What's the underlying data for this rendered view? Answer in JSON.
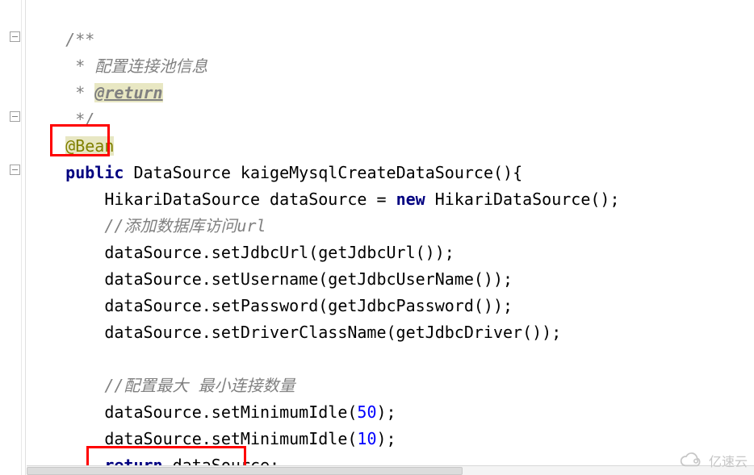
{
  "code": {
    "l1": "    /**",
    "l2_a": "     * ",
    "l2_b": "配置连接池信息",
    "l3_a": "     * ",
    "l3_b": "@return",
    "l4": "     */",
    "l5_a": "    ",
    "l5_b": "@Bean",
    "l6_a": "    ",
    "l6_b": "public",
    "l6_c": " DataSource kaigeMysqlCreateDataSource(){",
    "l7_a": "        HikariDataSource dataSource = ",
    "l7_b": "new",
    "l7_c": " HikariDataSource();",
    "l8_a": "        ",
    "l8_b": "//添加数据库访问url",
    "l9": "        dataSource.setJdbcUrl(getJdbcUrl());",
    "l10": "        dataSource.setUsername(getJdbcUserName());",
    "l11": "        dataSource.setPassword(getJdbcPassword());",
    "l12": "        dataSource.setDriverClassName(getJdbcDriver());",
    "l13": "",
    "l14_a": "        ",
    "l14_b": "//配置最大 最小连接数量",
    "l15_a": "        dataSource.setMinimumIdle(",
    "l15_b": "50",
    "l15_c": ");",
    "l16_a": "        dataSource.setMinimumIdle(",
    "l16_b": "10",
    "l16_c": ");",
    "l17_a": "        ",
    "l17_b": "return",
    "l17_c": " dataSource;"
  },
  "watermark": {
    "text": "亿速云"
  }
}
